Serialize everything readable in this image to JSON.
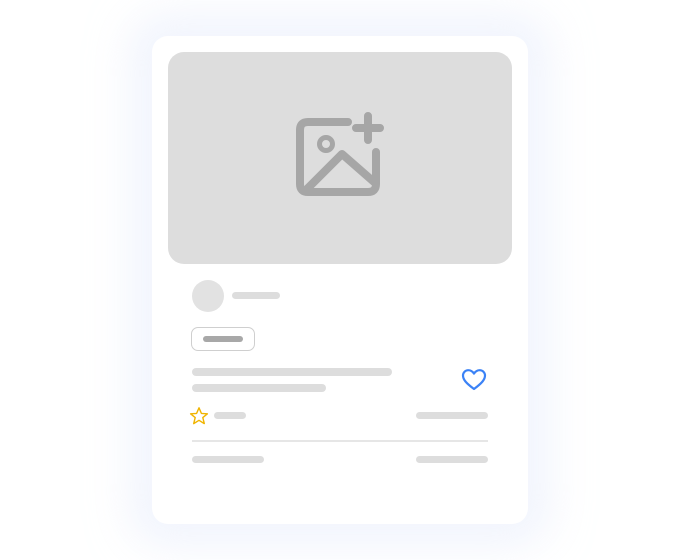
{
  "card": {
    "state": "loading-skeleton",
    "media_icon": "image-add-icon",
    "favorite_icon": "heart-outline-icon",
    "rating_icon": "star-outline-icon"
  },
  "colors": {
    "skeleton": "#dddddd",
    "media_background": "#dddddd",
    "icon_gray": "#a6a6a6",
    "favorite_accent": "#3b82f6",
    "rating_accent": "#f0b400",
    "tag_border": "#cfcfcf",
    "divider": "#e6e6e6"
  }
}
